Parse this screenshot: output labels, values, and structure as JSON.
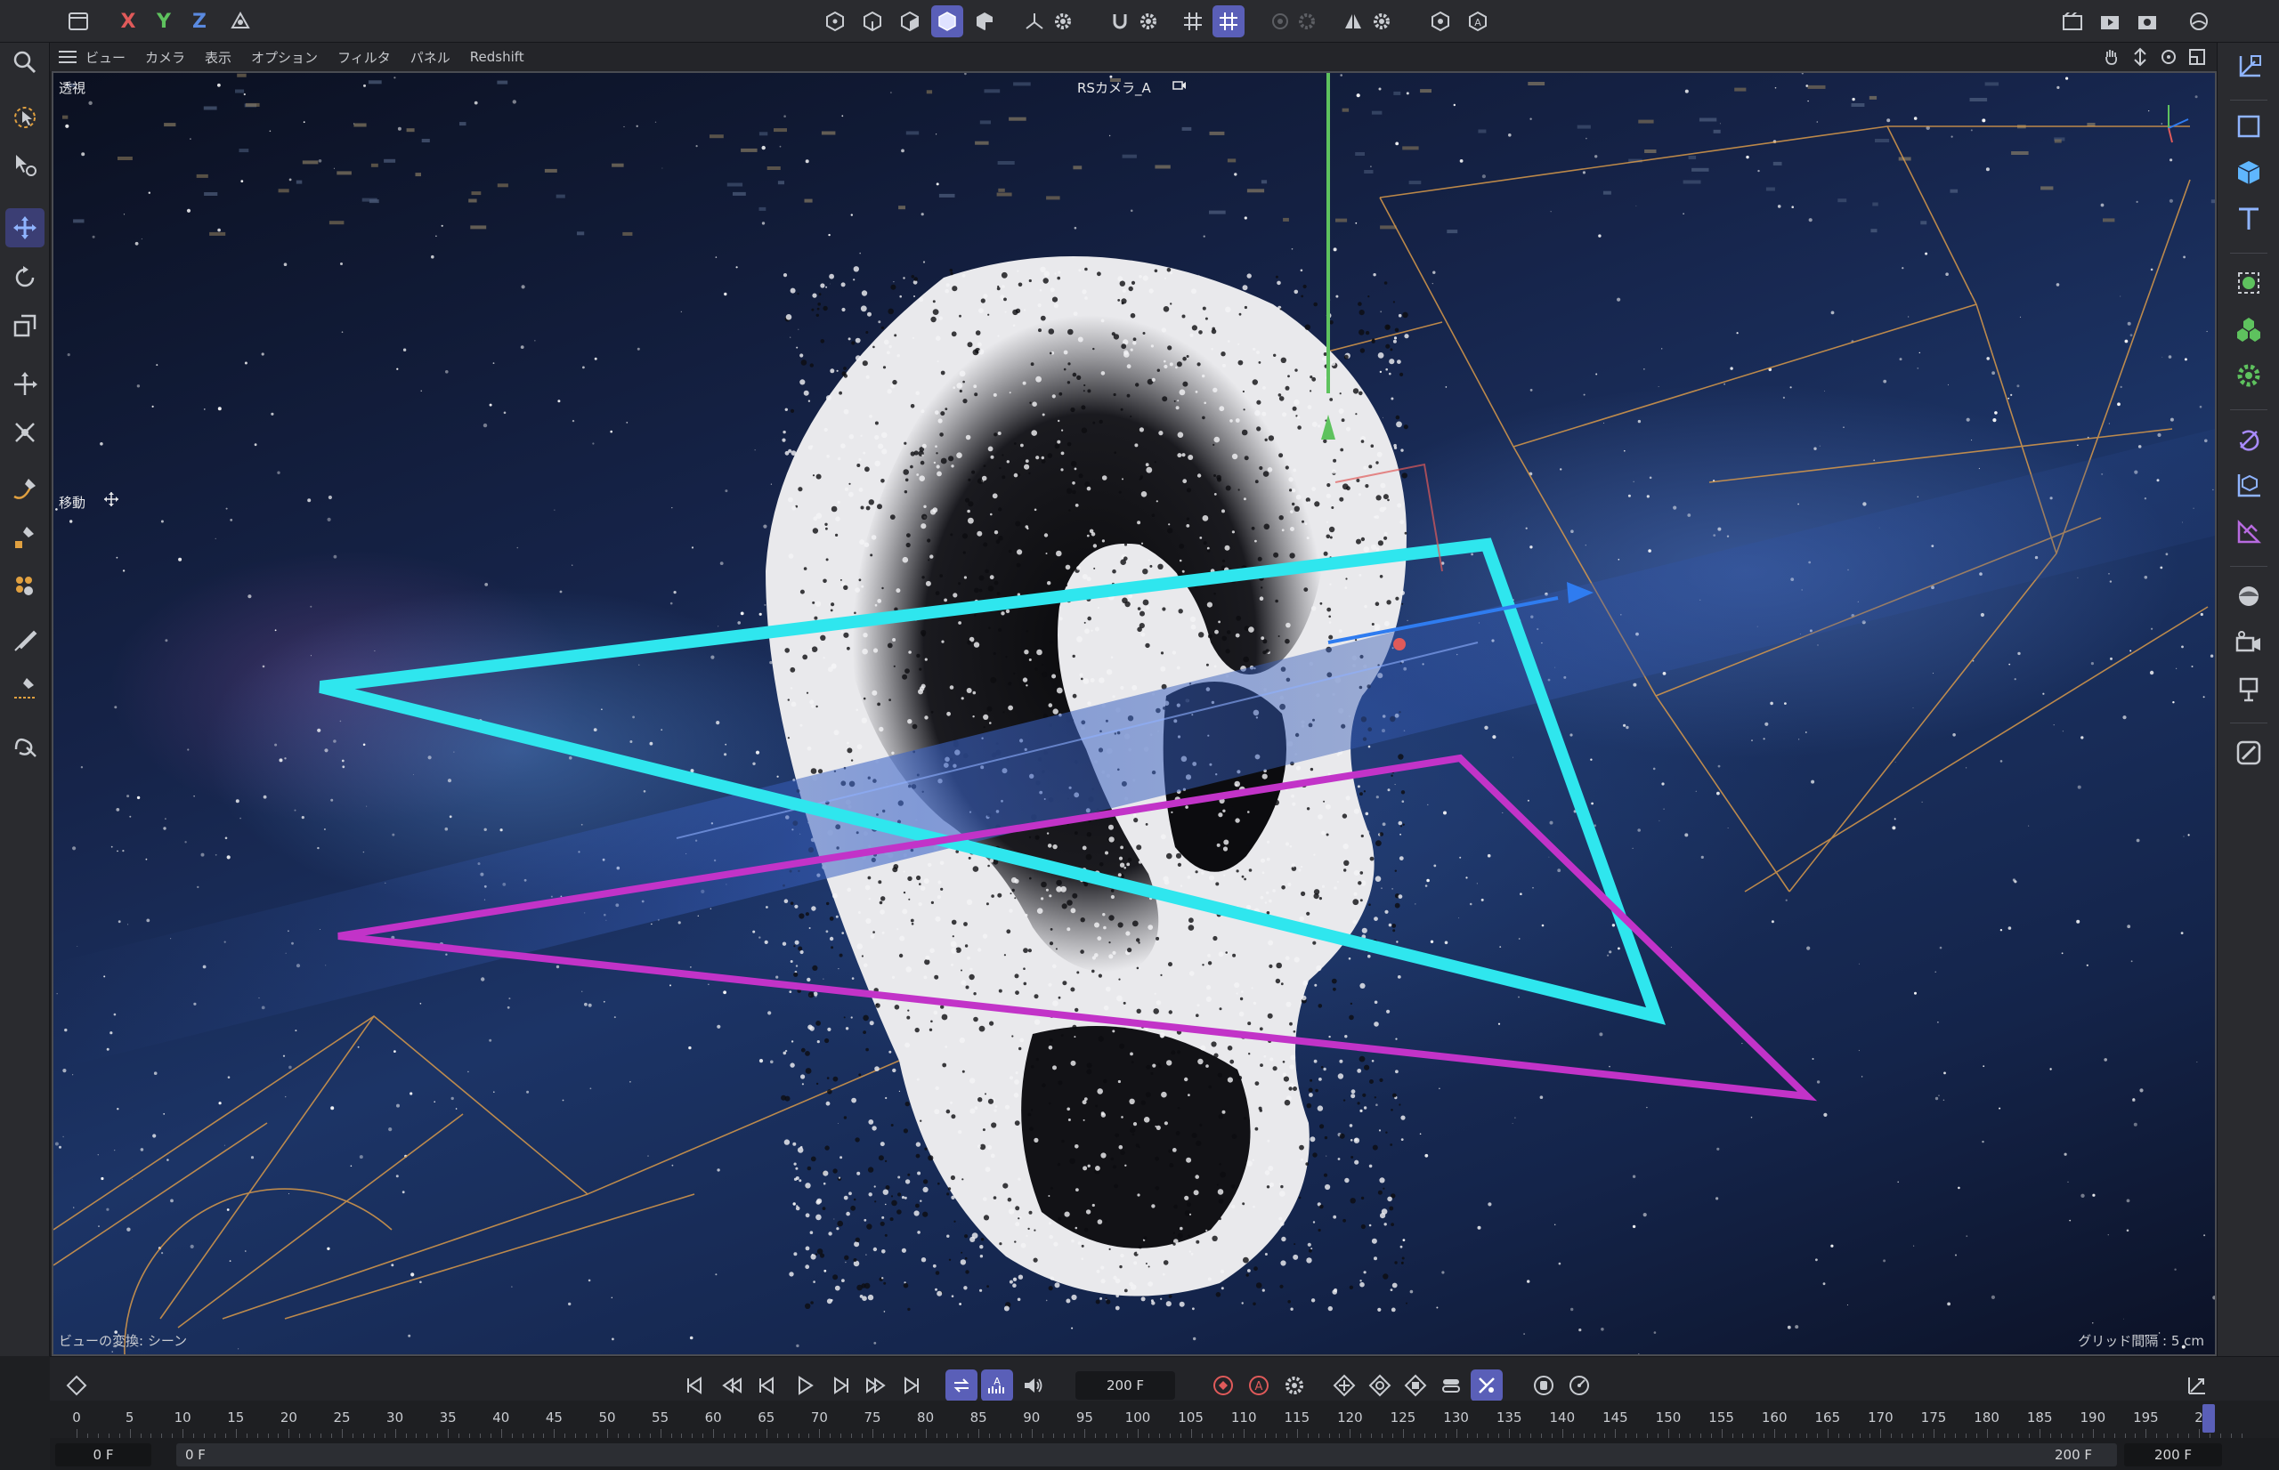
{
  "menu": {
    "items": [
      "ビュー",
      "カメラ",
      "表示",
      "オプション",
      "フィルタ",
      "パネル",
      "Redshift"
    ]
  },
  "axes": {
    "x": "X",
    "y": "Y",
    "z": "Z"
  },
  "viewport": {
    "projection": "透視",
    "camera": "RSカメラ_A",
    "tool": "移動",
    "status": "ビューの変換: シーン",
    "grid": "グリッド間隔 : 5 cm"
  },
  "timeline": {
    "current_frame": "200 F",
    "ticks": [
      "0",
      "5",
      "10",
      "15",
      "20",
      "25",
      "30",
      "35",
      "40",
      "45",
      "50",
      "55",
      "60",
      "65",
      "70",
      "75",
      "80",
      "85",
      "90",
      "95",
      "100",
      "105",
      "110",
      "115",
      "120",
      "125",
      "130",
      "135",
      "140",
      "145",
      "150",
      "155",
      "160",
      "165",
      "170",
      "175",
      "180",
      "185",
      "190",
      "195",
      "2"
    ],
    "range_start": "0 F",
    "range_min": "0 F",
    "range_end": "200 F",
    "range_max": "200 F"
  },
  "colors": {
    "accent": "#5a5fb8",
    "axis_x": "#e05a5a",
    "axis_y": "#5ec25e",
    "axis_z": "#5a8ae0",
    "cyan_triangle": "#2fe6ee",
    "magenta_triangle": "#c233c8",
    "guide_lines": "#d99a4a"
  },
  "icons": {
    "top_toolbar": [
      "panel-icon",
      "axis-x-icon",
      "axis-y-icon",
      "axis-z-icon",
      "coordinate-system-icon",
      "point-mode-icon",
      "edge-mode-icon",
      "polygon-mode-icon",
      "model-mode-icon",
      "texture-mode-icon",
      "axis-mode-icon",
      "gear-icon",
      "snap-icon",
      "gear-icon",
      "grid-icon",
      "grid-active-icon",
      "render-region-icon",
      "symmetry-icon",
      "deformer-icon",
      "auto-icon",
      "render-view-icon",
      "render-icon",
      "render-settings-icon",
      "scene-icon"
    ],
    "left_toolbar": [
      "search-icon",
      "live-select-icon",
      "select-tool-icon",
      "move-icon",
      "rotate-icon",
      "scale-icon",
      "transform-icon",
      "combined-icon",
      "spline-pen-icon",
      "paint-icon",
      "brush-icon",
      "sculpt-icon",
      "knife-icon",
      "magnet-icon"
    ],
    "right_toolbar": [
      "null-object-icon",
      "square-icon",
      "cube-icon",
      "text-icon",
      "mograph-icon",
      "cloner-icon",
      "effector-icon",
      "deformer-icon",
      "generator-icon",
      "field-icon",
      "environment-icon",
      "camera-icon",
      "light-icon",
      "tag-icon"
    ]
  }
}
